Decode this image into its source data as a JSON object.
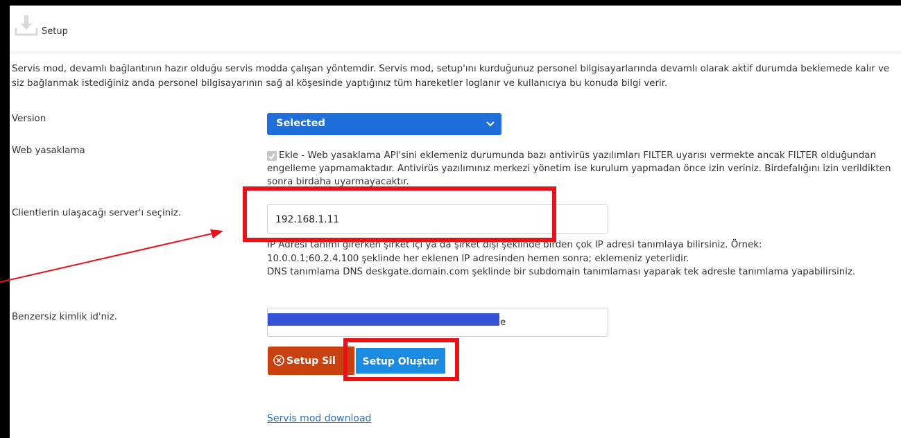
{
  "header": {
    "title": "Setup",
    "icon": "download-icon"
  },
  "description": "Servis mod, devamlı bağlantının hazır olduğu servis modda çalışan yöntemdir. Servis mod, setup'ını kurduğunuz personel bilgisayarlarında devamlı olarak aktif durumda beklemede kalır ve siz bağlanmak istediğiniz anda personel bilgisayarının sağ al köşesinde yaptığınız tüm hareketler loglanır ve kullanıcıya bu konuda bilgi verir.",
  "version": {
    "label": "Version",
    "selected": "Selected"
  },
  "web_block": {
    "label": "Web yasaklama",
    "checked": true,
    "text": "Ekle - Web yasaklama API'sini eklemeniz durumunda bazı antivirüs yazılımları FILTER uyarısı vermekte ancak FILTER olduğundan engelleme yapmamaktadır. Antivirüs yazılımınız merkezi yönetim ise kurulum yapmadan önce izin veriniz. Birdefalığını izin verildikten sonra birdaha uyarmayacaktır."
  },
  "server": {
    "label": "Clientlerin ulaşacağı server'ı seçiniz.",
    "value": "192.168.1.11",
    "help_line1": "IP Adresi tanımı girerken şirket içi ya da şirket dışı şeklinde birden çok IP adresi tanımlaya bilirsiniz. Örnek:",
    "help_line2": "10.0.0.1;60.2.4.100 şeklinde her eklenen IP adresinden hemen sonra; eklemeniz yeterlidir.",
    "help_line3": "DNS tanımlama DNS deskgate.domain.com şeklinde bir subdomain tanımlaması yaparak tek adresle tanımlama yapabilirsiniz."
  },
  "unique_id": {
    "label": "Benzersiz kimlik id'niz.",
    "visible_tail": "e"
  },
  "buttons": {
    "delete_label": "Setup Sil",
    "create_label": "Setup Oluştur"
  },
  "download_link": "Servis mod download",
  "colors": {
    "select_bg": "#1e6fd9",
    "delete_bg": "#c9410e",
    "create_bg": "#1a8be0",
    "annotation": "#e8121b",
    "redaction": "#3453d6"
  }
}
